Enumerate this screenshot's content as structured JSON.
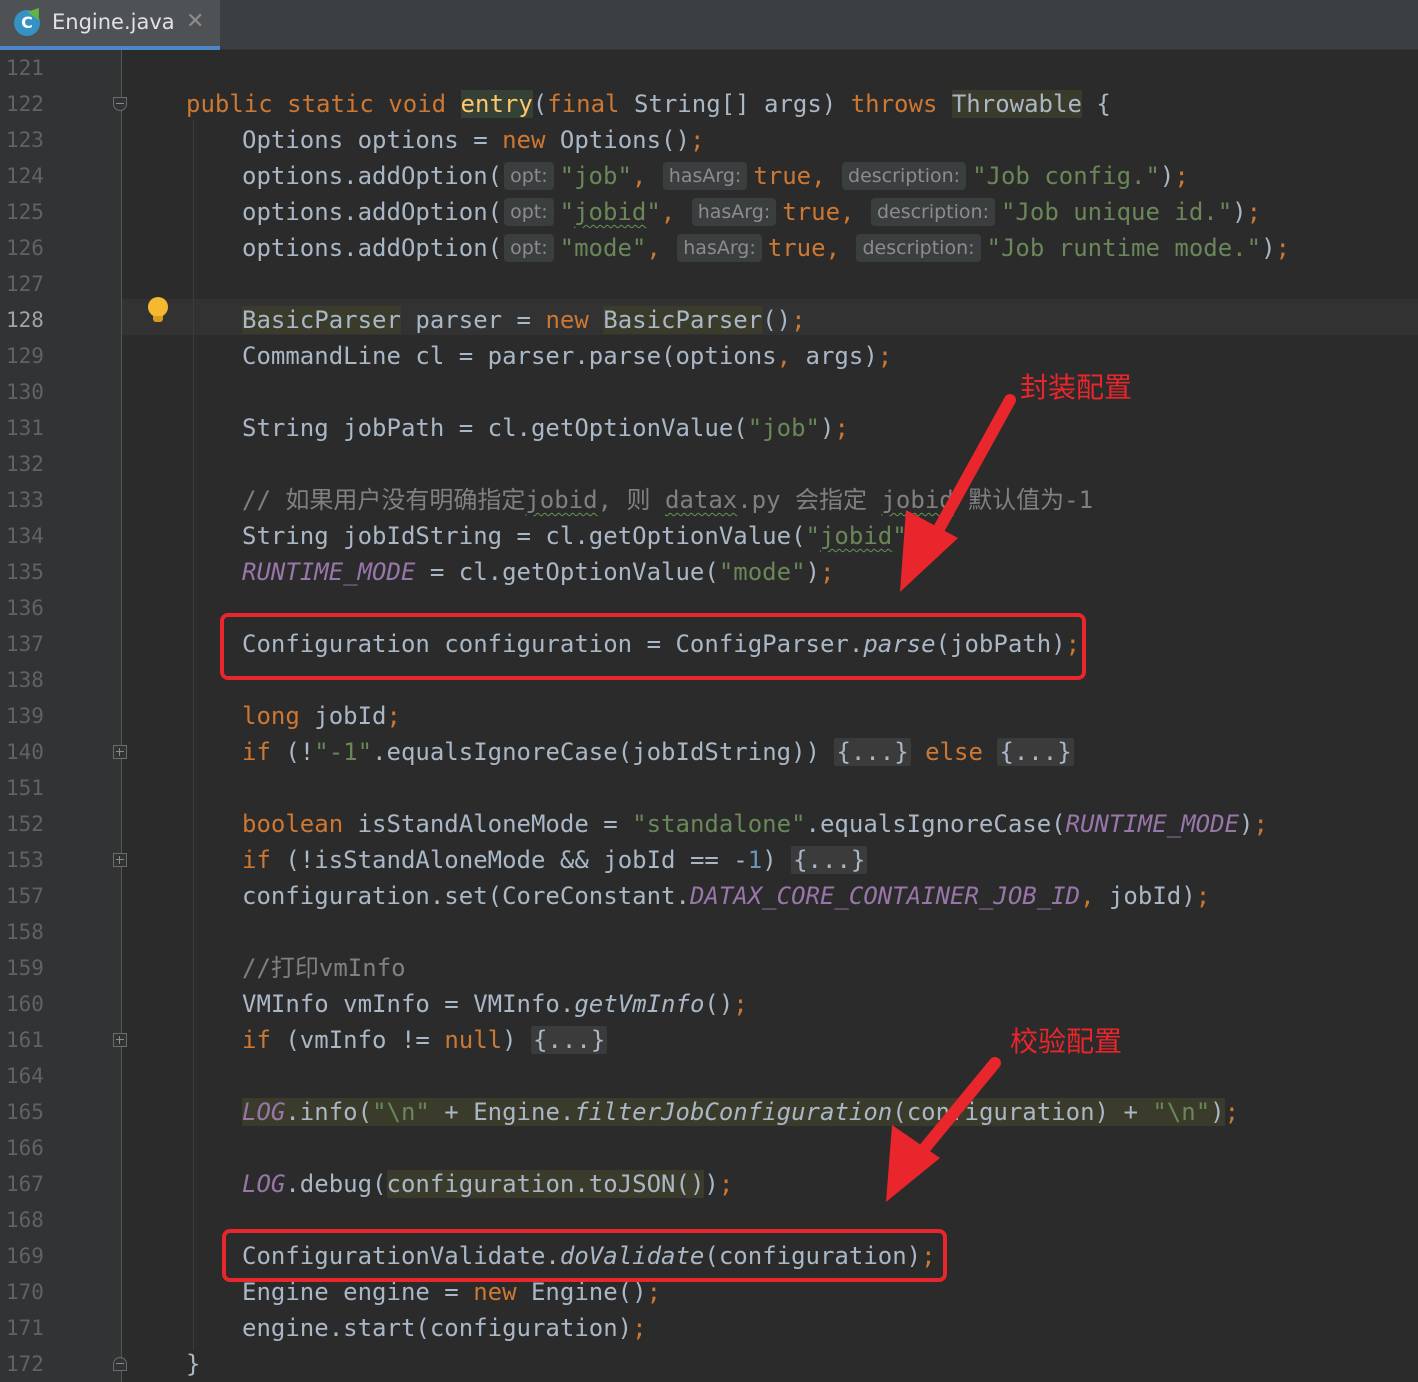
{
  "tab": {
    "title": "Engine.java",
    "icon": "java-class-icon",
    "close_symbol": "✕",
    "active": true
  },
  "colors": {
    "keyword": "#cc7832",
    "string": "#6a8759",
    "number": "#6897bb",
    "comment": "#808080",
    "field": "#9876aa",
    "default_text": "#a9b7c6",
    "annotation_red": "#e8262c",
    "background": "#2b2b2b"
  },
  "editor": {
    "current_line": "128",
    "lines": [
      {
        "n": "121"
      },
      {
        "n": "122",
        "fold": "open",
        "segments": [
          {
            "t": "public static void ",
            "c": "kw"
          },
          {
            "t": "entry",
            "c": "fn"
          },
          {
            "t": "(",
            "c": ""
          },
          {
            "t": "final ",
            "c": "kw"
          },
          {
            "t": "String[] args) ",
            "c": ""
          },
          {
            "t": "throws ",
            "c": "kw"
          },
          {
            "t": "Throwable",
            "c": "hl"
          },
          {
            "t": " {",
            "c": ""
          }
        ]
      },
      {
        "n": "123",
        "segments": [
          {
            "t": "Options options = ",
            "c": ""
          },
          {
            "t": "new ",
            "c": "kw"
          },
          {
            "t": "Options()",
            "c": ""
          },
          {
            "t": ";",
            "c": "kw"
          }
        ]
      },
      {
        "n": "124",
        "segments": [
          {
            "t": "options.addOption(",
            "c": ""
          },
          {
            "t": "opt:",
            "c": "hint"
          },
          {
            "t": "\"job\"",
            "c": "str"
          },
          {
            "t": ", ",
            "c": "kw"
          },
          {
            "t": "hasArg:",
            "c": "hint"
          },
          {
            "t": "true",
            "c": "kw"
          },
          {
            "t": ", ",
            "c": "kw"
          },
          {
            "t": "description:",
            "c": "hint"
          },
          {
            "t": "\"Job config.\"",
            "c": "str"
          },
          {
            "t": ")",
            "c": ""
          },
          {
            "t": ";",
            "c": "kw"
          }
        ]
      },
      {
        "n": "125",
        "segments": [
          {
            "t": "options.addOption(",
            "c": ""
          },
          {
            "t": "opt:",
            "c": "hint"
          },
          {
            "t": "\"",
            "c": "str"
          },
          {
            "t": "jobid",
            "c": "str typo"
          },
          {
            "t": "\"",
            "c": "str"
          },
          {
            "t": ", ",
            "c": "kw"
          },
          {
            "t": "hasArg:",
            "c": "hint"
          },
          {
            "t": "true",
            "c": "kw"
          },
          {
            "t": ", ",
            "c": "kw"
          },
          {
            "t": "description:",
            "c": "hint"
          },
          {
            "t": "\"Job unique id.\"",
            "c": "str"
          },
          {
            "t": ")",
            "c": ""
          },
          {
            "t": ";",
            "c": "kw"
          }
        ]
      },
      {
        "n": "126",
        "segments": [
          {
            "t": "options.addOption(",
            "c": ""
          },
          {
            "t": "opt:",
            "c": "hint"
          },
          {
            "t": "\"mode\"",
            "c": "str"
          },
          {
            "t": ", ",
            "c": "kw"
          },
          {
            "t": "hasArg:",
            "c": "hint"
          },
          {
            "t": "true",
            "c": "kw"
          },
          {
            "t": ", ",
            "c": "kw"
          },
          {
            "t": "description:",
            "c": "hint"
          },
          {
            "t": "\"Job runtime mode.\"",
            "c": "str"
          },
          {
            "t": ")",
            "c": ""
          },
          {
            "t": ";",
            "c": "kw"
          }
        ]
      },
      {
        "n": "127"
      },
      {
        "n": "128",
        "current": true,
        "segments": [
          {
            "t": "BasicParser",
            "c": "hl"
          },
          {
            "t": " parser = ",
            "c": ""
          },
          {
            "t": "new ",
            "c": "kw"
          },
          {
            "t": "BasicParser",
            "c": "hl"
          },
          {
            "t": "()",
            "c": ""
          },
          {
            "t": ";",
            "c": "kw"
          }
        ]
      },
      {
        "n": "129",
        "segments": [
          {
            "t": "CommandLine cl = parser.parse(options",
            "c": ""
          },
          {
            "t": ", ",
            "c": "kw"
          },
          {
            "t": "args)",
            "c": ""
          },
          {
            "t": ";",
            "c": "kw"
          }
        ]
      },
      {
        "n": "130"
      },
      {
        "n": "131",
        "segments": [
          {
            "t": "String jobPath = cl.getOptionValue(",
            "c": ""
          },
          {
            "t": "\"job\"",
            "c": "str"
          },
          {
            "t": ")",
            "c": ""
          },
          {
            "t": ";",
            "c": "kw"
          }
        ]
      },
      {
        "n": "132"
      },
      {
        "n": "133",
        "segments": [
          {
            "t": "// 如果用户没有明确指定",
            "c": "cm"
          },
          {
            "t": "jobid",
            "c": "cm typo"
          },
          {
            "t": ", 则 ",
            "c": "cm"
          },
          {
            "t": "datax",
            "c": "cm typo"
          },
          {
            "t": ".py 会指定 ",
            "c": "cm"
          },
          {
            "t": "jobid",
            "c": "cm typo"
          },
          {
            "t": " 默认值为-1",
            "c": "cm"
          }
        ]
      },
      {
        "n": "134",
        "segments": [
          {
            "t": "String jobIdString = cl.getOptionValue(",
            "c": ""
          },
          {
            "t": "\"",
            "c": "str"
          },
          {
            "t": "jobid",
            "c": "str typo"
          },
          {
            "t": "\"",
            "c": "str"
          },
          {
            "t": ")",
            "c": ""
          },
          {
            "t": ";",
            "c": "kw"
          }
        ]
      },
      {
        "n": "135",
        "segments": [
          {
            "t": "RUNTIME_MODE",
            "c": "fld"
          },
          {
            "t": " = cl.getOptionValue(",
            "c": ""
          },
          {
            "t": "\"mode\"",
            "c": "str"
          },
          {
            "t": ")",
            "c": ""
          },
          {
            "t": ";",
            "c": "kw"
          }
        ]
      },
      {
        "n": "136"
      },
      {
        "n": "137",
        "segments": [
          {
            "t": "Configuration configuration = ConfigParser.",
            "c": ""
          },
          {
            "t": "parse",
            "c": "it"
          },
          {
            "t": "(jobPath)",
            "c": ""
          },
          {
            "t": ";",
            "c": "kw"
          }
        ]
      },
      {
        "n": "138"
      },
      {
        "n": "139",
        "segments": [
          {
            "t": "long ",
            "c": "kw"
          },
          {
            "t": "jobId",
            "c": ""
          },
          {
            "t": ";",
            "c": "kw"
          }
        ]
      },
      {
        "n": "140",
        "fold": "plus",
        "segments": [
          {
            "t": "if ",
            "c": "kw"
          },
          {
            "t": "(!",
            "c": ""
          },
          {
            "t": "\"-1\"",
            "c": "str"
          },
          {
            "t": ".equalsIgnoreCase(jobIdString)) ",
            "c": ""
          },
          {
            "t": "{...}",
            "c": "fold-ph"
          },
          {
            "t": " else ",
            "c": "kw"
          },
          {
            "t": "{...}",
            "c": "fold-ph"
          }
        ]
      },
      {
        "n": "151"
      },
      {
        "n": "152",
        "segments": [
          {
            "t": "boolean ",
            "c": "kw"
          },
          {
            "t": "isStandAloneMode = ",
            "c": ""
          },
          {
            "t": "\"standalone\"",
            "c": "str"
          },
          {
            "t": ".equalsIgnoreCase(",
            "c": ""
          },
          {
            "t": "RUNTIME_MODE",
            "c": "fld"
          },
          {
            "t": ")",
            "c": ""
          },
          {
            "t": ";",
            "c": "kw"
          }
        ]
      },
      {
        "n": "153",
        "fold": "plus",
        "segments": [
          {
            "t": "if ",
            "c": "kw"
          },
          {
            "t": "(!isStandAloneMode && jobId == -",
            "c": ""
          },
          {
            "t": "1",
            "c": "num"
          },
          {
            "t": ") ",
            "c": ""
          },
          {
            "t": "{...}",
            "c": "fold-ph"
          }
        ]
      },
      {
        "n": "157",
        "segments": [
          {
            "t": "configuration.set(CoreConstant.",
            "c": ""
          },
          {
            "t": "DATAX_CORE_CONTAINER_JOB_ID",
            "c": "fld"
          },
          {
            "t": ", ",
            "c": "kw"
          },
          {
            "t": "jobId)",
            "c": ""
          },
          {
            "t": ";",
            "c": "kw"
          }
        ]
      },
      {
        "n": "158"
      },
      {
        "n": "159",
        "segments": [
          {
            "t": "//打印vmInfo",
            "c": "cm"
          }
        ]
      },
      {
        "n": "160",
        "segments": [
          {
            "t": "VMInfo vmInfo = VMInfo.",
            "c": ""
          },
          {
            "t": "getVmInfo",
            "c": "it"
          },
          {
            "t": "()",
            "c": ""
          },
          {
            "t": ";",
            "c": "kw"
          }
        ]
      },
      {
        "n": "161",
        "fold": "plus",
        "segments": [
          {
            "t": "if ",
            "c": "kw"
          },
          {
            "t": "(vmInfo != ",
            "c": ""
          },
          {
            "t": "null",
            "c": "kw"
          },
          {
            "t": ") ",
            "c": ""
          },
          {
            "t": "{...}",
            "c": "fold-ph"
          }
        ]
      },
      {
        "n": "164"
      },
      {
        "n": "165",
        "segments": [
          {
            "t": "LOG",
            "c": "fld hl"
          },
          {
            "t": ".info(",
            "c": "hl"
          },
          {
            "t": "\"\\n\"",
            "c": "str hl"
          },
          {
            "t": " + Engine.",
            "c": "hl"
          },
          {
            "t": "filterJobConfiguration",
            "c": "it hl"
          },
          {
            "t": "(configuration) + ",
            "c": "hl"
          },
          {
            "t": "\"\\n\"",
            "c": "str hl"
          },
          {
            "t": ")",
            "c": "hl"
          },
          {
            "t": ";",
            "c": "kw"
          }
        ]
      },
      {
        "n": "166"
      },
      {
        "n": "167",
        "segments": [
          {
            "t": "LOG",
            "c": "fld"
          },
          {
            "t": ".debug(",
            "c": ""
          },
          {
            "t": "configuration.toJSON()",
            "c": "hl"
          },
          {
            "t": ")",
            "c": ""
          },
          {
            "t": ";",
            "c": "kw"
          }
        ]
      },
      {
        "n": "168"
      },
      {
        "n": "169",
        "segments": [
          {
            "t": "ConfigurationValidate.",
            "c": ""
          },
          {
            "t": "doValidate",
            "c": "it"
          },
          {
            "t": "(configuration)",
            "c": ""
          },
          {
            "t": ";",
            "c": "kw"
          }
        ]
      },
      {
        "n": "170",
        "segments": [
          {
            "t": "Engine engine = ",
            "c": ""
          },
          {
            "t": "new ",
            "c": "kw"
          },
          {
            "t": "Engine()",
            "c": ""
          },
          {
            "t": ";",
            "c": "kw"
          }
        ]
      },
      {
        "n": "171",
        "segments": [
          {
            "t": "engine.start(configuration)",
            "c": ""
          },
          {
            "t": ";",
            "c": "kw"
          }
        ]
      },
      {
        "n": "172",
        "fold": "close",
        "segments": [
          {
            "t": "}",
            "c": ""
          }
        ]
      }
    ]
  },
  "annotations": {
    "config_wrap_label": "封装配置",
    "config_validate_label": "校验配置"
  }
}
